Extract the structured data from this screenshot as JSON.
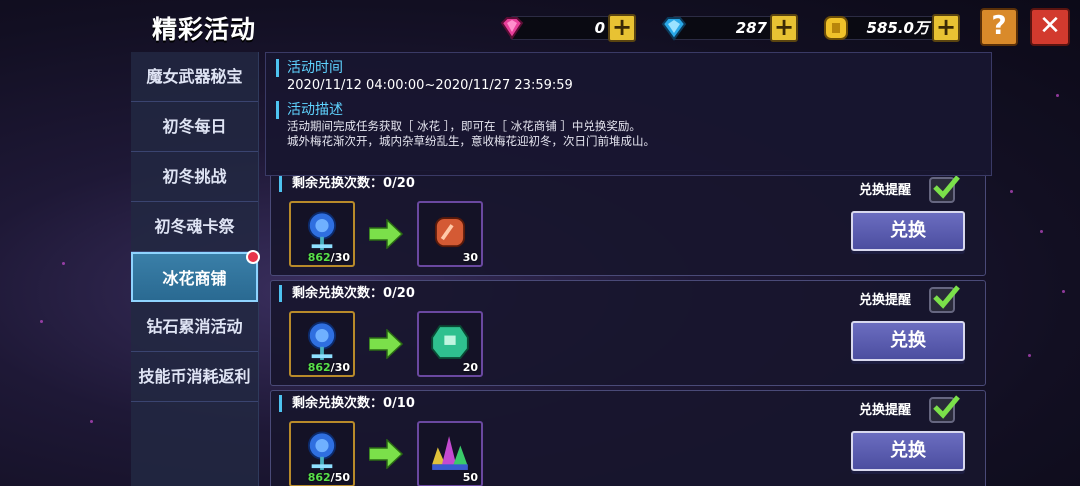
{
  "header": {
    "title": "精彩活动",
    "currencies": [
      {
        "icon": "pink-gem-icon",
        "value": "0"
      },
      {
        "icon": "blue-diamond-icon",
        "value": "287"
      },
      {
        "icon": "gold-coin-icon",
        "value": "585.0万"
      }
    ],
    "plus_label": "+",
    "help_label": "?",
    "close_label": "✕"
  },
  "sidebar": {
    "items": [
      {
        "label": "魔女武器秘宝"
      },
      {
        "label": "初冬每日"
      },
      {
        "label": "初冬挑战"
      },
      {
        "label": "初冬魂卡祭"
      },
      {
        "label": "冰花商铺"
      },
      {
        "label": "钻石累消活动"
      },
      {
        "label": "技能币消耗返利"
      }
    ],
    "active_index": 4
  },
  "info": {
    "time_heading": "活动时间",
    "time_value": "2020/11/12 04:00:00~2020/11/27 23:59:59",
    "desc_heading": "活动描述",
    "desc_line1": "活动期间完成任务获取［ 冰花 ］，即可在［ 冰花商铺 ］中兑换奖励。",
    "desc_line2": "城外梅花渐次开，城内杂草纷乱生，意收梅花迎初冬，次日门前堆成山。"
  },
  "exchanges": [
    {
      "remaining": "剩余兑换次数：0/20",
      "cost_have": "862",
      "cost_need": "/30",
      "reward_icon": "red-orb-icon",
      "reward_count": "30",
      "remind_label": "兑换提醒",
      "button_label": "兑换"
    },
    {
      "remaining": "剩余兑换次数：0/20",
      "cost_have": "862",
      "cost_need": "/30",
      "reward_icon": "green-gem-icon",
      "reward_count": "20",
      "remind_label": "兑换提醒",
      "button_label": "兑换"
    },
    {
      "remaining": "剩余兑换次数：0/10",
      "cost_have": "862",
      "cost_need": "/50",
      "reward_icon": "crystal-cluster-icon",
      "reward_count": "50",
      "remind_label": "兑换提醒",
      "button_label": "兑换"
    }
  ],
  "colors": {
    "accent_blue": "#4ec3f0",
    "active_tab": "#3a7fa8",
    "button": "#5a5cb0",
    "have_count": "#58e04a"
  }
}
